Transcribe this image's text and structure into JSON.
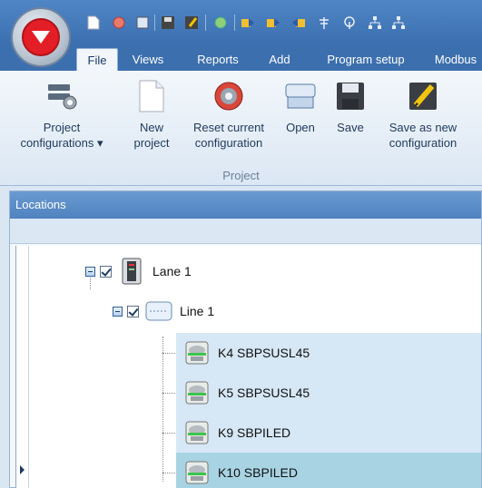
{
  "ribbon_tabs": [
    {
      "label": "File",
      "active": true
    },
    {
      "label": "Views",
      "active": false
    },
    {
      "label": "Reports",
      "active": false
    },
    {
      "label": "Add",
      "active": false
    },
    {
      "label": "Program setup",
      "active": false
    },
    {
      "label": "Modbus",
      "active": false
    }
  ],
  "quick_access": [
    "new-file-icon",
    "reset-icon",
    "open-icon",
    "save-icon",
    "save-as-icon",
    "settings-icon",
    "export-icon",
    "import-icon",
    "antenna-icon",
    "signal-icon",
    "network-icon",
    "network2-icon"
  ],
  "ribbon": {
    "project_configurations": "Project\nconfigurations ▾",
    "new_project": "New\nproject",
    "reset_configuration": "Reset current\nconfiguration",
    "open": "Open",
    "save": "Save",
    "save_as_new": "Save as new\nconfiguration",
    "group_label": "Project"
  },
  "panel": {
    "title": "Locations"
  },
  "tree": {
    "lane": "Lane 1",
    "line": "Line 1",
    "sensors": [
      "K4 SBPSUSL45",
      "K5 SBPSUSL45",
      "K9 SBPILED",
      "K10 SBPILED"
    ]
  },
  "colors": {
    "accent": "#3c6fae",
    "selected_row": "#a8d3e3",
    "highlight_row": "#d6e7f5",
    "brand_red": "#e41e26"
  }
}
